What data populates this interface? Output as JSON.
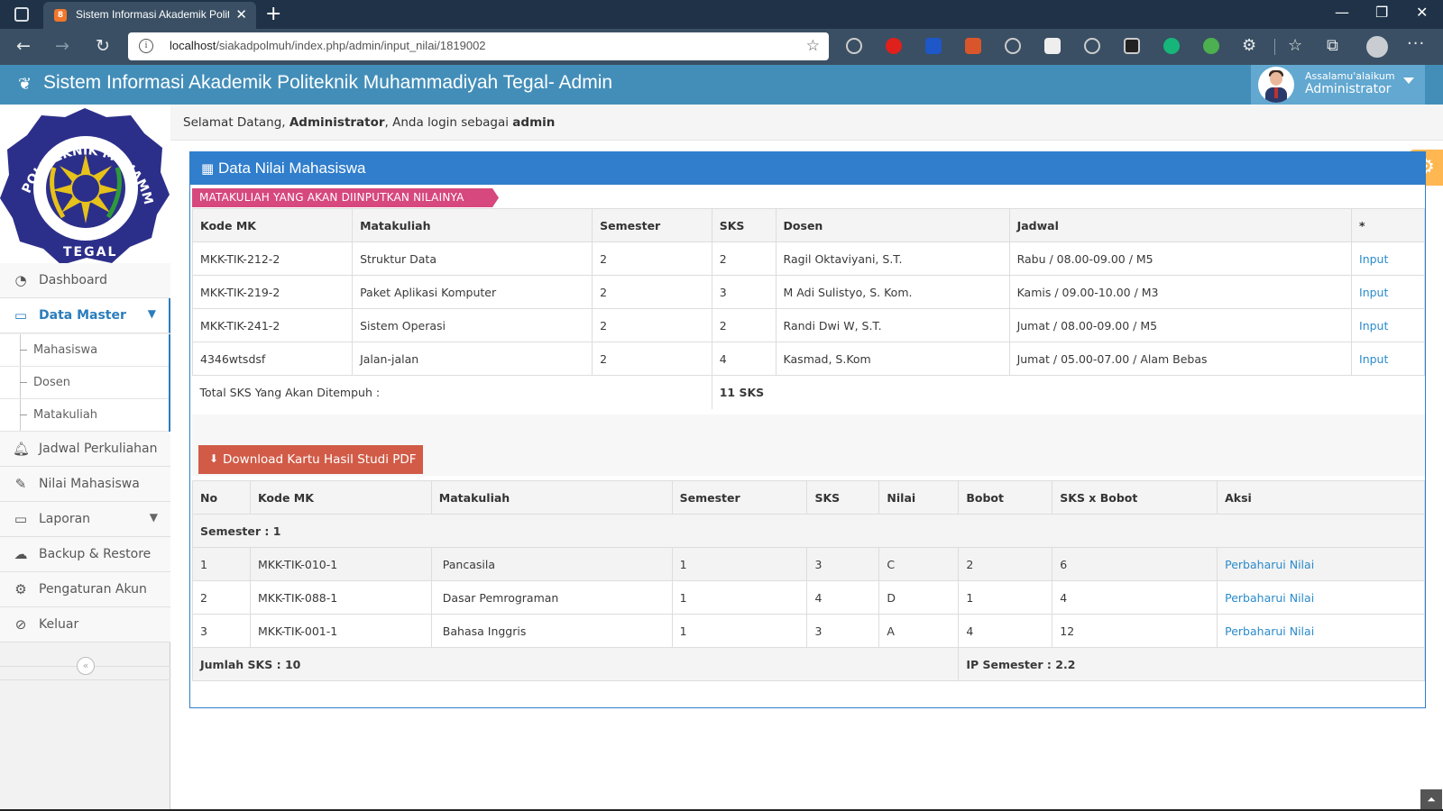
{
  "browser": {
    "tab_title": "Sistem Informasi Akademik Politeknik Muhammadiyah Tegal",
    "tab_favicon_text": "8",
    "url_host": "localhost",
    "url_path": "/siakadpolmuh/index.php/admin/input_nilai/1819002",
    "icons": [
      "back-icon",
      "forward-icon",
      "reload-icon",
      "info-icon",
      "add-favorite-icon",
      "extension-icons",
      "favorites-icon",
      "collections-icon",
      "profile-icon",
      "menu-icon"
    ]
  },
  "app": {
    "title": "Sistem Informasi Akademik Politeknik Muhammadiyah Tegal- Admin",
    "user_greeting": "Assalamu'alaikum",
    "user_name": "Administrator",
    "accent": "#438eb9",
    "panel_color": "#307ecc",
    "ribbon_color": "#d6487e",
    "button_color": "#d15b47"
  },
  "logo": {
    "top_text": "POLITEKNIK MUHAMMADIYAH",
    "bottom_text": "TEGAL"
  },
  "sidebar": {
    "items": [
      {
        "label": "Dashboard",
        "icon": "tachometer-icon"
      },
      {
        "label": "Data Master",
        "icon": "card-icon"
      },
      {
        "label": "Jadwal Perkuliahan",
        "icon": "bell-icon"
      },
      {
        "label": "Nilai Mahasiswa",
        "icon": "edit-icon"
      },
      {
        "label": "Laporan",
        "icon": "card-icon"
      },
      {
        "label": "Backup & Restore",
        "icon": "cloud-download-icon"
      },
      {
        "label": "Pengaturan Akun",
        "icon": "cogs-icon"
      },
      {
        "label": "Keluar",
        "icon": "ban-icon"
      }
    ],
    "submenu": [
      "Mahasiswa",
      "Dosen",
      "Matakuliah"
    ]
  },
  "welcome": {
    "prefix": "Selamat Datang, ",
    "name": "Administrator",
    "middle": ", Anda login sebagai ",
    "role": "admin"
  },
  "panel": {
    "title": "Data Nilai Mahasiswa",
    "ribbon": "MATAKULIAH YANG AKAN DIINPUTKAN NILAINYA"
  },
  "courses_table": {
    "headers": [
      "Kode MK",
      "Matakuliah",
      "Semester",
      "SKS",
      "Dosen",
      "Jadwal",
      "*"
    ],
    "rows": [
      {
        "kode": "MKK-TIK-212-2",
        "mk": "Struktur Data",
        "sem": "2",
        "sks": "2",
        "dosen": "Ragil Oktaviyani, S.T.",
        "jadwal": "Rabu / 08.00-09.00 / M5",
        "aksi": "Input"
      },
      {
        "kode": "MKK-TIK-219-2",
        "mk": "Paket Aplikasi Komputer",
        "sem": "2",
        "sks": "3",
        "dosen": "M Adi Sulistyo, S. Kom.",
        "jadwal": "Kamis / 09.00-10.00 / M3",
        "aksi": "Input"
      },
      {
        "kode": "MKK-TIK-241-2",
        "mk": "Sistem Operasi",
        "sem": "2",
        "sks": "2",
        "dosen": "Randi Dwi W, S.T.",
        "jadwal": "Jumat / 08.00-09.00 / M5",
        "aksi": "Input"
      },
      {
        "kode": "4346wtsdsf",
        "mk": "Jalan-jalan",
        "sem": "2",
        "sks": "4",
        "dosen": "Kasmad, S.Kom",
        "jadwal": "Jumat / 05.00-07.00 / Alam Bebas",
        "aksi": "Input"
      }
    ],
    "total_label": "Total SKS Yang Akan Ditempuh :",
    "total_value": "11 SKS"
  },
  "download_button": "Download Kartu Hasil Studi PDF",
  "grades_table": {
    "headers": [
      "No",
      "Kode MK",
      "Matakuliah",
      "Semester",
      "SKS",
      "Nilai",
      "Bobot",
      "SKS x Bobot",
      "Aksi"
    ],
    "semester_label": "Semester : 1",
    "rows": [
      {
        "no": "1",
        "kode": "MKK-TIK-010-1",
        "mk": "Pancasila",
        "sem": "1",
        "sks": "3",
        "nilai": "C",
        "bobot": "2",
        "skb": "6",
        "aksi": "Perbaharui Nilai"
      },
      {
        "no": "2",
        "kode": "MKK-TIK-088-1",
        "mk": "Dasar Pemrograman",
        "sem": "1",
        "sks": "4",
        "nilai": "D",
        "bobot": "1",
        "skb": "4",
        "aksi": "Perbaharui Nilai"
      },
      {
        "no": "3",
        "kode": "MKK-TIK-001-1",
        "mk": "Bahasa Inggris",
        "sem": "1",
        "sks": "3",
        "nilai": "A",
        "bobot": "4",
        "skb": "12",
        "aksi": "Perbaharui Nilai"
      }
    ],
    "jumlah_sks": "Jumlah SKS : 10",
    "ip_semester": "IP Semester : 2.2"
  }
}
